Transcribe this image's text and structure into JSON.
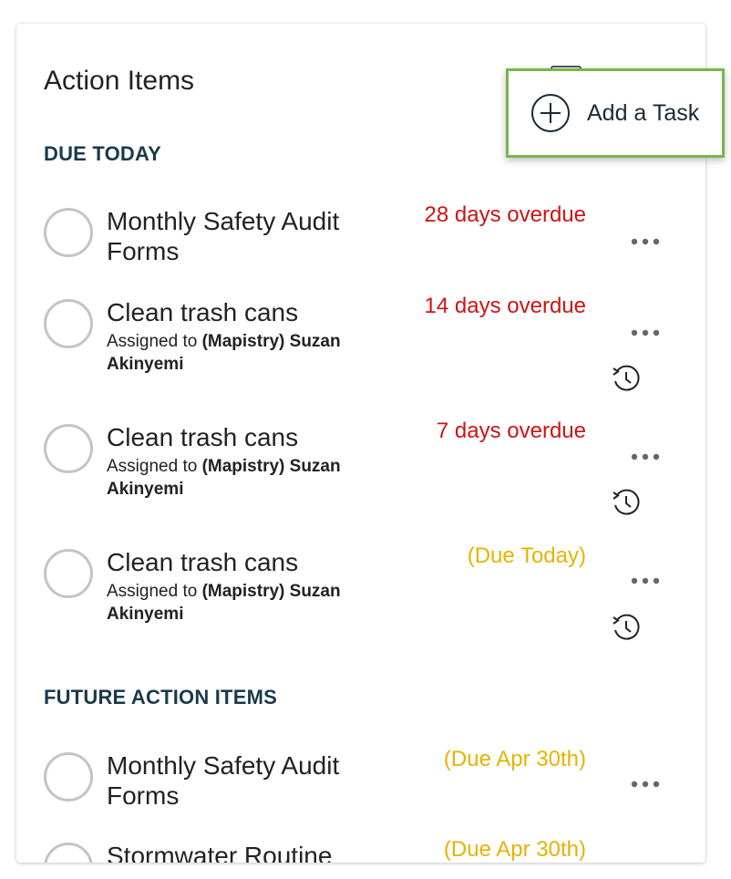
{
  "panel": {
    "title": "Action Items"
  },
  "sections": {
    "due_today": "DUE TODAY",
    "future": "FUTURE ACTION ITEMS"
  },
  "tasks": [
    {
      "title": "Monthly Safety Audit Forms",
      "status": "28 days overdue",
      "status_type": "overdue"
    },
    {
      "title": "Clean trash cans",
      "assigned_prefix": "Assigned to ",
      "assignee": "(Mapistry) Suzan Akinyemi",
      "status": "14 days overdue",
      "status_type": "overdue",
      "recurring": true
    },
    {
      "title": "Clean trash cans",
      "assigned_prefix": "Assigned to ",
      "assignee": "(Mapistry) Suzan Akinyemi",
      "status": "7 days overdue",
      "status_type": "overdue",
      "recurring": true
    },
    {
      "title": "Clean trash cans",
      "assigned_prefix": "Assigned to ",
      "assignee": "(Mapistry) Suzan Akinyemi",
      "status": "(Due Today)",
      "status_type": "due",
      "recurring": true
    },
    {
      "title": "Monthly Safety Audit Forms",
      "status": "(Due Apr 30th)",
      "status_type": "due"
    },
    {
      "title": "Stormwater Routine",
      "status": "(Due Apr 30th)",
      "status_type": "due"
    }
  ],
  "add_task": {
    "label": "Add a Task"
  },
  "icons": {
    "add": "plus-circle-icon",
    "more": "more-horizontal-icon",
    "recurring": "recurring-clock-icon"
  },
  "colors": {
    "overdue": "#cc1414",
    "due": "#e8b200",
    "heading": "#1b3a4b",
    "highlight_border": "#7ab648"
  }
}
